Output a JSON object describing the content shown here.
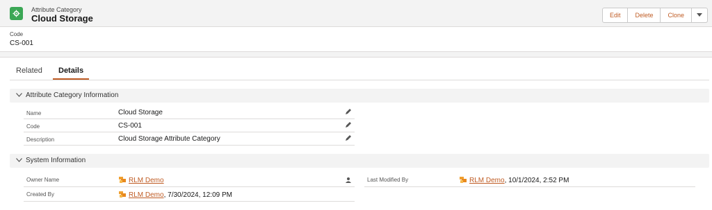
{
  "header": {
    "object_label": "Attribute Category",
    "record_title": "Cloud Storage",
    "buttons": {
      "edit": "Edit",
      "delete": "Delete",
      "clone": "Clone"
    },
    "highlights": {
      "code_label": "Code",
      "code_value": "CS-001"
    }
  },
  "tabs": {
    "related": "Related",
    "details": "Details",
    "active": "Details"
  },
  "sections": {
    "attribute_info": {
      "title": "Attribute Category Information",
      "fields": [
        {
          "label": "Name",
          "value": "Cloud Storage"
        },
        {
          "label": "Code",
          "value": "CS-001"
        },
        {
          "label": "Description",
          "value": "Cloud Storage Attribute Category"
        }
      ]
    },
    "system_info": {
      "title": "System Information",
      "owner_label": "Owner Name",
      "owner_value": "RLM Demo",
      "created_label": "Created By",
      "created_user": "RLM Demo",
      "created_date": ", 7/30/2024, 12:09 PM",
      "modified_label": "Last Modified By",
      "modified_user": "RLM Demo",
      "modified_date": ", 10/1/2024, 2:52 PM"
    }
  },
  "colors": {
    "accent": "#bf5b23",
    "object_icon": "#3ba755"
  }
}
